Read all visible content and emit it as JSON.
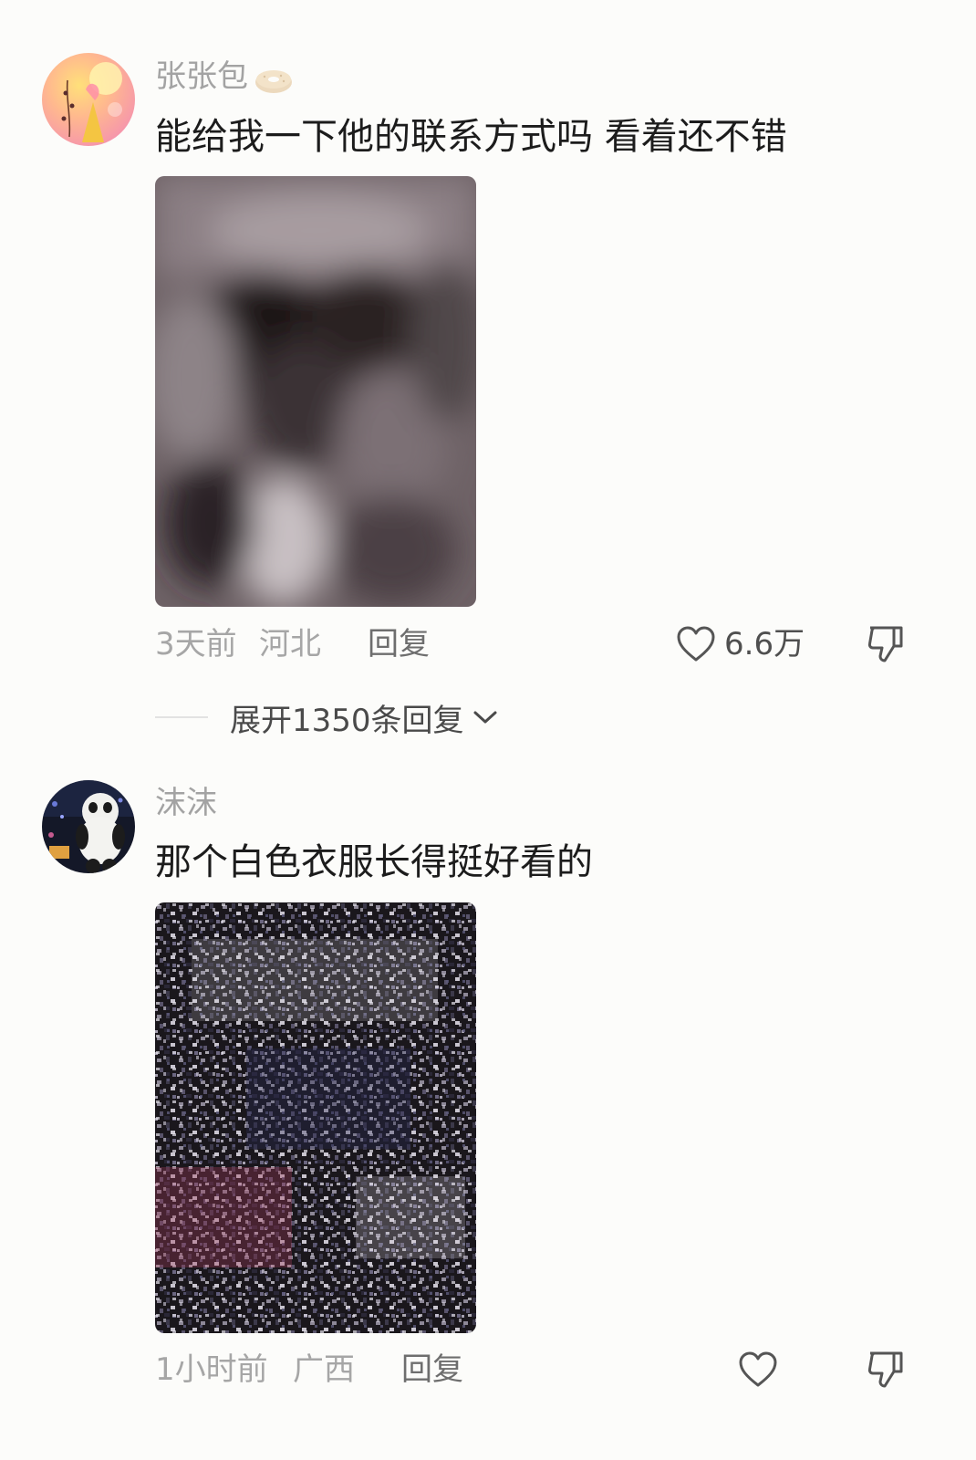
{
  "comments": [
    {
      "username": "张张包",
      "badge_icon": "bagel-badge-icon",
      "text": "能给我一下他的联系方式吗 看着还不错",
      "time": "3天前",
      "location": "河北",
      "reply_label": "回复",
      "like_count": "6.6万",
      "expand_label": "展开1350条回复"
    },
    {
      "username": "沫沫",
      "text": "那个白色衣服长得挺好看的",
      "time": "1小时前",
      "location": "广西",
      "reply_label": "回复",
      "like_count": ""
    }
  ],
  "colors": {
    "background": "#fcfcfa",
    "username": "#a3a3a3",
    "meta": "#a6a6a6",
    "text": "#1c1c1c"
  }
}
